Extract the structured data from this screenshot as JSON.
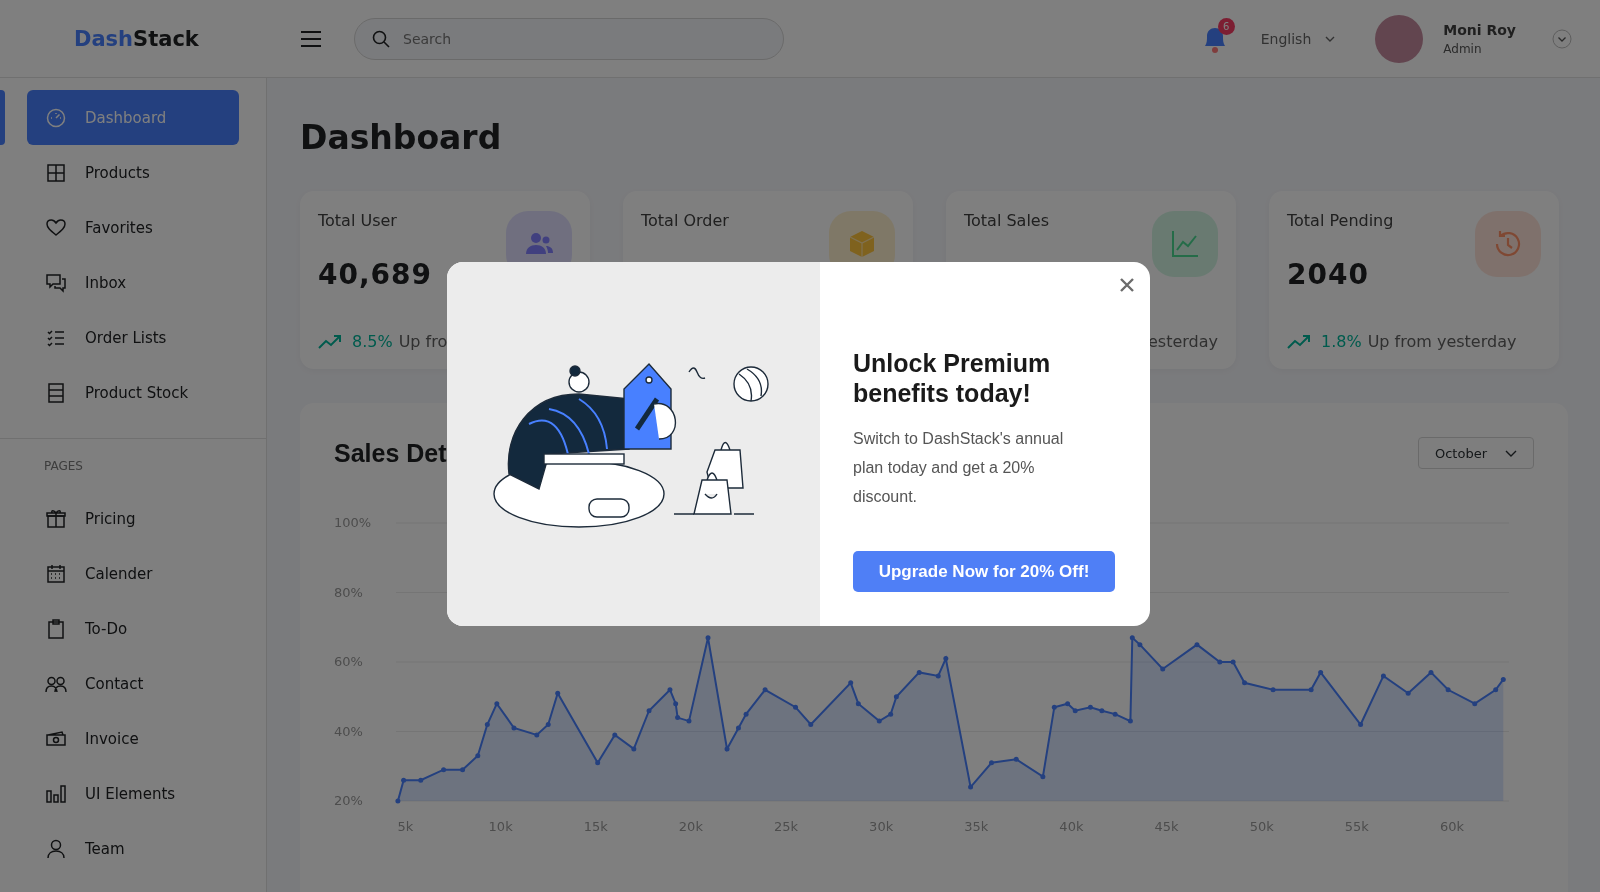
{
  "brand": {
    "part1": "Dash",
    "part2": "Stack"
  },
  "search": {
    "placeholder": "Search"
  },
  "notifications": {
    "count": "6"
  },
  "language": "English",
  "user": {
    "name": "Moni Roy",
    "role": "Admin"
  },
  "sidebar": {
    "items": [
      {
        "label": "Dashboard",
        "kind": "gauge",
        "selected": true
      },
      {
        "label": "Products",
        "kind": "grid",
        "selected": false
      },
      {
        "label": "Favorites",
        "kind": "heart",
        "selected": false
      },
      {
        "label": "Inbox",
        "kind": "chat",
        "selected": false
      },
      {
        "label": "Order Lists",
        "kind": "list",
        "selected": false
      },
      {
        "label": "Product Stock",
        "kind": "stock",
        "selected": false
      }
    ],
    "section_label": "PAGES",
    "pages": [
      {
        "label": "Pricing",
        "kind": "gift",
        "selected": false
      },
      {
        "label": "Calender",
        "kind": "calendar",
        "selected": false
      },
      {
        "label": "To-Do",
        "kind": "clipboard",
        "selected": false
      },
      {
        "label": "Contact",
        "kind": "people",
        "selected": false
      },
      {
        "label": "Invoice",
        "kind": "cash",
        "selected": false
      },
      {
        "label": "UI Elements",
        "kind": "bars",
        "selected": false
      },
      {
        "label": "Team",
        "kind": "person",
        "selected": false
      }
    ]
  },
  "page_title": "Dashboard",
  "cards": [
    {
      "title": "Total User",
      "value": "40,689",
      "kind": "users",
      "pct": "8.5%",
      "trend_text": "Up fro"
    },
    {
      "title": "Total Order",
      "kind": "box"
    },
    {
      "title": "Total Sales",
      "kind": "chart",
      "trend_text": "esterday"
    },
    {
      "title": "Total Pending",
      "value": "2040",
      "kind": "clock",
      "pct": "1.8%",
      "trend_text": "Up from yesterday"
    }
  ],
  "sales": {
    "title": "Sales Det",
    "month": "October",
    "chart_data": {
      "type": "area",
      "grid": true,
      "xlim": [
        4.5,
        63
      ],
      "ylim": [
        20,
        100
      ],
      "xticks": [
        {
          "value": 5,
          "label": "5k"
        },
        {
          "value": 10,
          "label": "10k"
        },
        {
          "value": 15,
          "label": "15k"
        },
        {
          "value": 20,
          "label": "20k"
        },
        {
          "value": 25,
          "label": "25k"
        },
        {
          "value": 30,
          "label": "30k"
        },
        {
          "value": 35,
          "label": "35k"
        },
        {
          "value": 40,
          "label": "40k"
        },
        {
          "value": 45,
          "label": "45k"
        },
        {
          "value": 50,
          "label": "50k"
        },
        {
          "value": 55,
          "label": "55k"
        },
        {
          "value": 60,
          "label": "60k"
        }
      ],
      "yticks": [
        {
          "value": 20,
          "label": "20%"
        },
        {
          "value": 40,
          "label": "40%"
        },
        {
          "value": 60,
          "label": "60%"
        },
        {
          "value": 80,
          "label": "80%"
        },
        {
          "value": 100,
          "label": "100%"
        }
      ],
      "x": [
        4.6,
        4.9,
        5.8,
        7.0,
        8.0,
        8.8,
        9.3,
        9.8,
        10.7,
        11.9,
        12.5,
        13.0,
        15.1,
        16.0,
        17.0,
        17.8,
        18.9,
        19.2,
        19.3,
        19.9,
        20.9,
        21.9,
        22.5,
        22.9,
        23.9,
        25.5,
        26.3,
        28.4,
        28.8,
        29.9,
        30.5,
        30.8,
        32.0,
        33.0,
        33.4,
        34.7,
        35.8,
        37.1,
        38.5,
        39.1,
        39.8,
        40.2,
        41.0,
        41.6,
        42.3,
        43.1,
        43.2,
        43.6,
        44.8,
        46.6,
        47.8,
        48.5,
        49.1,
        50.6,
        52.6,
        53.1,
        55.2,
        56.4,
        57.7,
        58.9,
        59.8,
        61.2,
        62.3,
        62.7
      ],
      "series": [
        {
          "color": "#4880ff",
          "values": [
            20,
            26,
            26,
            29,
            29,
            33,
            42,
            48,
            41,
            39,
            42,
            51,
            31,
            39,
            35,
            46,
            52,
            48,
            44,
            43,
            67,
            35,
            41,
            45,
            52,
            47,
            42,
            54,
            48,
            43,
            45,
            50,
            57,
            56,
            61,
            24,
            31,
            32,
            27,
            47,
            48,
            46,
            47,
            46,
            45,
            43,
            67,
            65,
            58,
            65,
            60,
            60,
            54,
            52,
            52,
            57,
            42,
            56,
            51,
            57,
            52,
            48,
            52,
            55
          ]
        }
      ]
    }
  },
  "modal": {
    "title": "Unlock Premium benefits today!",
    "text": "Switch to DashStack's annual plan today and get a 20% discount.",
    "button": "Upgrade Now for 20% Off!"
  }
}
